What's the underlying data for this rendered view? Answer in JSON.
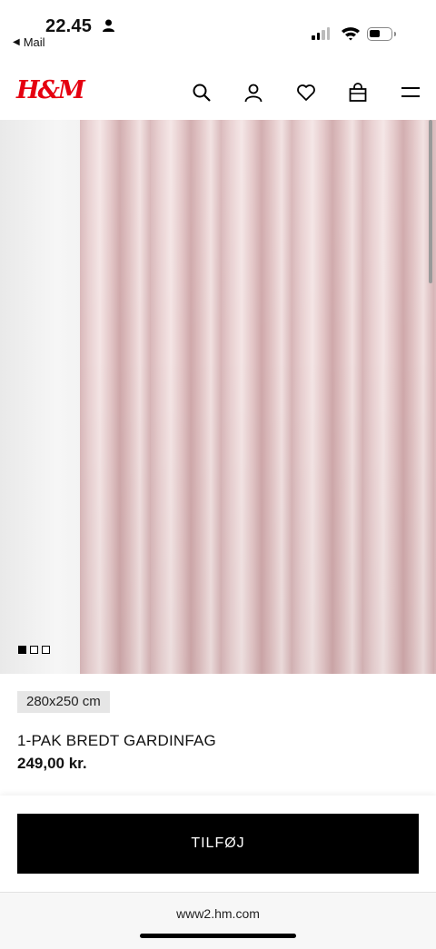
{
  "status_bar": {
    "time": "22.45",
    "back_app": "Mail"
  },
  "header": {
    "logo": "H&M",
    "icons": [
      "search-icon",
      "account-icon",
      "favorites-heart-icon",
      "shopping-bag-icon",
      "menu-icon"
    ]
  },
  "gallery": {
    "image_count": 3,
    "active_index": 0
  },
  "product": {
    "size": "280x250 cm",
    "name": "1-PAK BREDT GARDINFAG",
    "price": "249,00 kr."
  },
  "actions": {
    "add_label": "TILFØJ"
  },
  "browser": {
    "url": "www2.hm.com"
  },
  "colors": {
    "brand": "#e50010",
    "button": "#000000",
    "curtain": "#e3c6c7"
  }
}
